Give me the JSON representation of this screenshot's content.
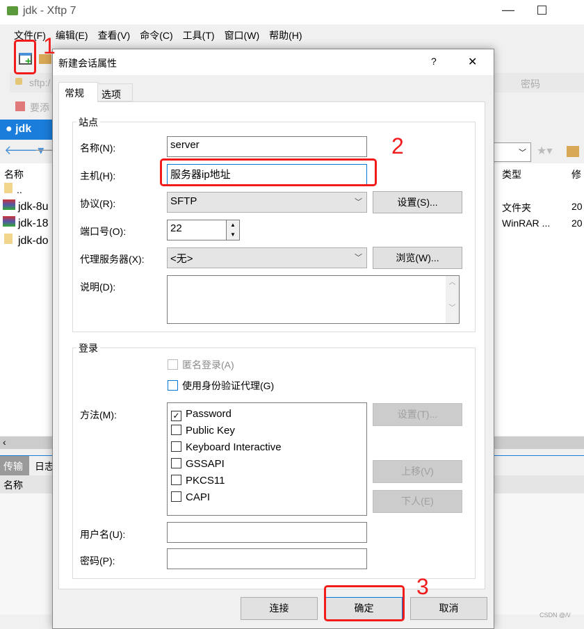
{
  "window": {
    "title": "jdk - Xftp 7"
  },
  "menu": [
    "文件(F)",
    "编辑(E)",
    "查看(V)",
    "命令(C)",
    "工具(T)",
    "窗口(W)",
    "帮助(H)"
  ],
  "address": {
    "text": "sftp:/",
    "password_label": "密码"
  },
  "hint": "要添",
  "session_tab": "jdk",
  "file_list": {
    "headers": {
      "name": "名称",
      "type": "类型",
      "modified": "修"
    },
    "rows": [
      {
        "name": "..",
        "type": "",
        "modified": ""
      },
      {
        "name": "jdk-8u",
        "type": "文件夹",
        "modified": "20"
      },
      {
        "name": "jdk-18",
        "type": "WinRAR ...",
        "modified": "20"
      },
      {
        "name": "jdk-do",
        "type": "",
        "modified": ""
      }
    ]
  },
  "bottom_panel": {
    "tabs": [
      "传输",
      "日志"
    ],
    "header": "名称"
  },
  "watermark": "CSDN @/\\/",
  "annotations": [
    "1",
    "2",
    "3"
  ],
  "dialog": {
    "title": "新建会话属性",
    "help": "?",
    "close": "✕",
    "tabs": [
      "常规",
      "选项"
    ],
    "site": {
      "group": "站点",
      "name_label": "名称(N):",
      "name_value": "server",
      "host_label": "主机(H):",
      "host_value": "服务器ip地址",
      "protocol_label": "协议(R):",
      "protocol_value": "SFTP",
      "settings_button": "设置(S)...",
      "port_label": "端口号(O):",
      "port_value": "22",
      "proxy_label": "代理服务器(X):",
      "proxy_value": "<无>",
      "browse_button": "浏览(W)...",
      "desc_label": "说明(D):",
      "desc_value": ""
    },
    "login": {
      "group": "登录",
      "anonymous": {
        "label": "匿名登录(A)",
        "checked": false,
        "disabled": true
      },
      "agent": {
        "label": "使用身份验证代理(G)",
        "checked": false
      },
      "method_label": "方法(M):",
      "methods": [
        {
          "label": "Password",
          "checked": true
        },
        {
          "label": "Public Key",
          "checked": false
        },
        {
          "label": "Keyboard Interactive",
          "checked": false
        },
        {
          "label": "GSSAPI",
          "checked": false
        },
        {
          "label": "PKCS11",
          "checked": false
        },
        {
          "label": "CAPI",
          "checked": false
        }
      ],
      "method_settings": "设置(T)...",
      "move_up": "上移(V)",
      "move_down": "下人(E)",
      "user_label": "用户名(U):",
      "user_value": "",
      "pass_label": "密码(P):",
      "pass_value": ""
    },
    "buttons": {
      "connect": "连接",
      "ok": "确定",
      "cancel": "取消"
    }
  }
}
